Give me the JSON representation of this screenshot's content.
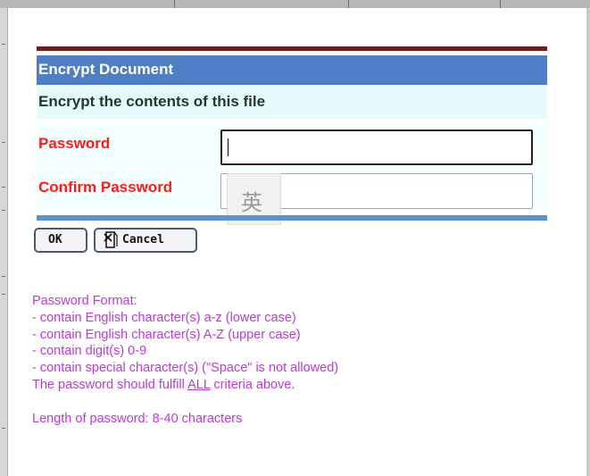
{
  "dialog": {
    "title": "Encrypt Document",
    "subtitle": "Encrypt the contents of this file",
    "password_label": "Password",
    "password_value": "",
    "confirm_label": "Confirm Password",
    "confirm_value": "",
    "ime_indicator": "英",
    "ok_label": "OK",
    "cancel_label": "Cancel",
    "cancel_icon": "cancel-icon"
  },
  "notes": {
    "heading": "Password Format:",
    "rules": [
      "- contain English character(s) a-z (lower case)",
      "- contain English character(s) A-Z (upper case)",
      "- contain digit(s) 0-9",
      "- contain special character(s) (\"Space\" is not allowed)"
    ],
    "fulfill_prefix": "The password should fulfill ",
    "fulfill_emphasis": "ALL",
    "fulfill_suffix": " criteria above.",
    "length": "Length of password: 8-40 characters"
  },
  "colors": {
    "header_bg": "#4f7ec6",
    "label_red": "#ff1a1a",
    "notes_purple": "#b93bd7",
    "top_rule": "#6b1f1f"
  }
}
